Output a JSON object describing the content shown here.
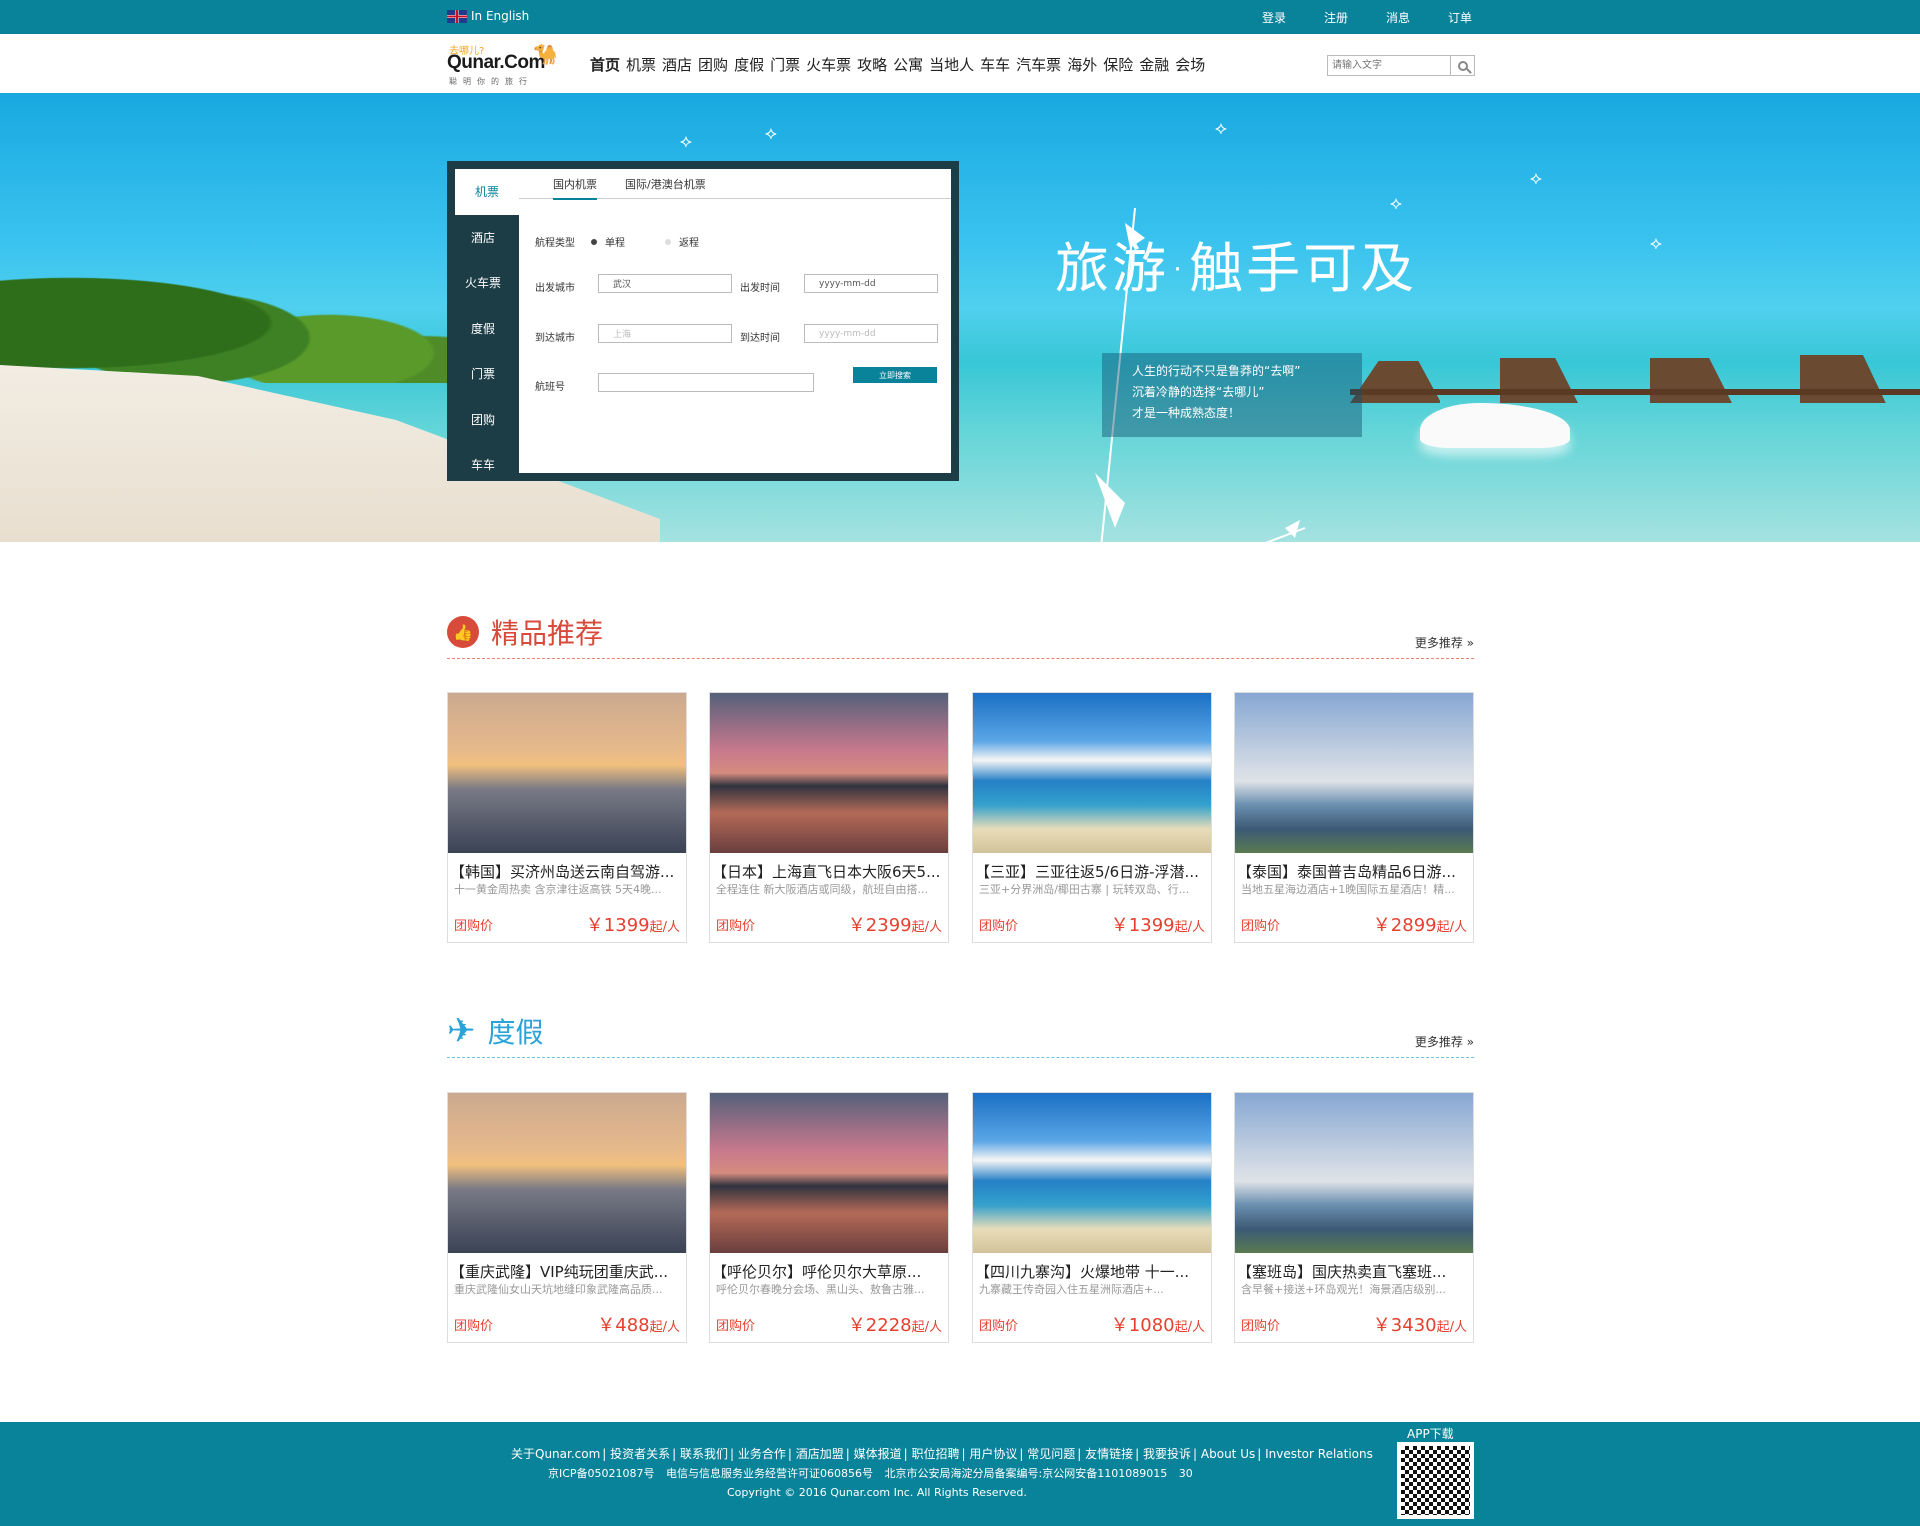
{
  "topbar": {
    "lang_label": "In English",
    "links": [
      "登录",
      "注册",
      "消息",
      "订单"
    ]
  },
  "logo": {
    "top": "去哪儿?",
    "name": "Qunar.Com",
    "slogan": "聪明你的旅行"
  },
  "nav": [
    "首页",
    "机票",
    "酒店",
    "团购",
    "度假",
    "门票",
    "火车票",
    "攻略",
    "公寓",
    "当地人",
    "车车",
    "汽车票",
    "海外",
    "保险",
    "金融",
    "会场"
  ],
  "search": {
    "placeholder": "请输入文字"
  },
  "panel": {
    "side": [
      "机票",
      "酒店",
      "火车票",
      "度假",
      "门票",
      "团购",
      "车车"
    ],
    "tabs": [
      "国内机票",
      "国际/港澳台机票"
    ],
    "trip_type_label": "航程类型",
    "trip_types": [
      "单程",
      "返程"
    ],
    "depart_city_label": "出发城市",
    "depart_city_value": "武汉",
    "depart_time_label": "出发时间",
    "depart_time_value": "yyyy-mm-dd",
    "arrive_city_label": "到达城市",
    "arrive_city_placeholder": "上海",
    "arrive_time_label": "到达时间",
    "arrive_time_placeholder": "yyyy-mm-dd",
    "flight_no_label": "航班号",
    "search_button": "立即搜索"
  },
  "banner": {
    "headline": "旅游·触手可及",
    "quote_lines": [
      "人生的行动不只是鲁莽的“去啊”",
      "沉着冷静的选择“去哪儿”",
      "才是一种成熟态度！"
    ]
  },
  "section1": {
    "title": "精品推荐",
    "more": "更多推荐 »",
    "accent": "#d84a3a",
    "cards": [
      {
        "name": "【韩国】买济州岛送云南自驾游...",
        "desc": "十一黄金周热卖 含京津往返高铁 5天4晚...",
        "label": "团购价",
        "price": "￥1399",
        "unit": "起/人"
      },
      {
        "name": "【日本】上海直飞日本大阪6天5...",
        "desc": "全程连住 新大阪酒店或同级，航班自由搭...",
        "label": "团购价",
        "price": "￥2399",
        "unit": "起/人"
      },
      {
        "name": "【三亚】三亚往返5/6日游-浮潜...",
        "desc": "三亚+分界洲岛/椰田古寨 | 玩转双岛、行...",
        "label": "团购价",
        "price": "￥1399",
        "unit": "起/人"
      },
      {
        "name": "【泰国】泰国普吉岛精品6日游...",
        "desc": "当地五星海边酒店+1晚国际五星酒店！精...",
        "label": "团购价",
        "price": "￥2899",
        "unit": "起/人"
      }
    ]
  },
  "section2": {
    "title": "度假",
    "more": "更多推荐 »",
    "accent": "#29a3d8",
    "cards": [
      {
        "name": "【重庆武隆】VIP纯玩团重庆武...",
        "desc": "重庆武隆仙女山天坑地缝印象武隆高品质...",
        "label": "团购价",
        "price": "￥488",
        "unit": "起/人"
      },
      {
        "name": "【呼伦贝尔】呼伦贝尔大草原...",
        "desc": "呼伦贝尔春晚分会场、黑山头、敖鲁古雅...",
        "label": "团购价",
        "price": "￥2228",
        "unit": "起/人"
      },
      {
        "name": "【四川九寨沟】火爆地带 十一...",
        "desc": "九寨藏王传奇园入住五星洲际酒店+...",
        "label": "团购价",
        "price": "￥1080",
        "unit": "起/人"
      },
      {
        "name": "【塞班岛】国庆热卖直飞塞班...",
        "desc": "含早餐+接送+环岛观光！海景酒店级别...",
        "label": "团购价",
        "price": "￥3430",
        "unit": "起/人"
      }
    ]
  },
  "footer": {
    "links": [
      "关于Qunar.com",
      "投资者关系",
      "联系我们",
      "业务合作",
      "酒店加盟",
      "媒体报道",
      "职位招聘",
      "用户协议",
      "常见问题",
      "友情链接",
      "我要投诉",
      "About Us",
      "Investor Relations"
    ],
    "line2": "京ICP备05021087号 电信与信息服务业务经营许可证060856号 北京市公安局海淀分局备案编号:京公网安备1101089015 30",
    "copyright": "Copyright © 2016 Qunar.com Inc. All Rights Reserved.",
    "app_download": "APP下载"
  }
}
